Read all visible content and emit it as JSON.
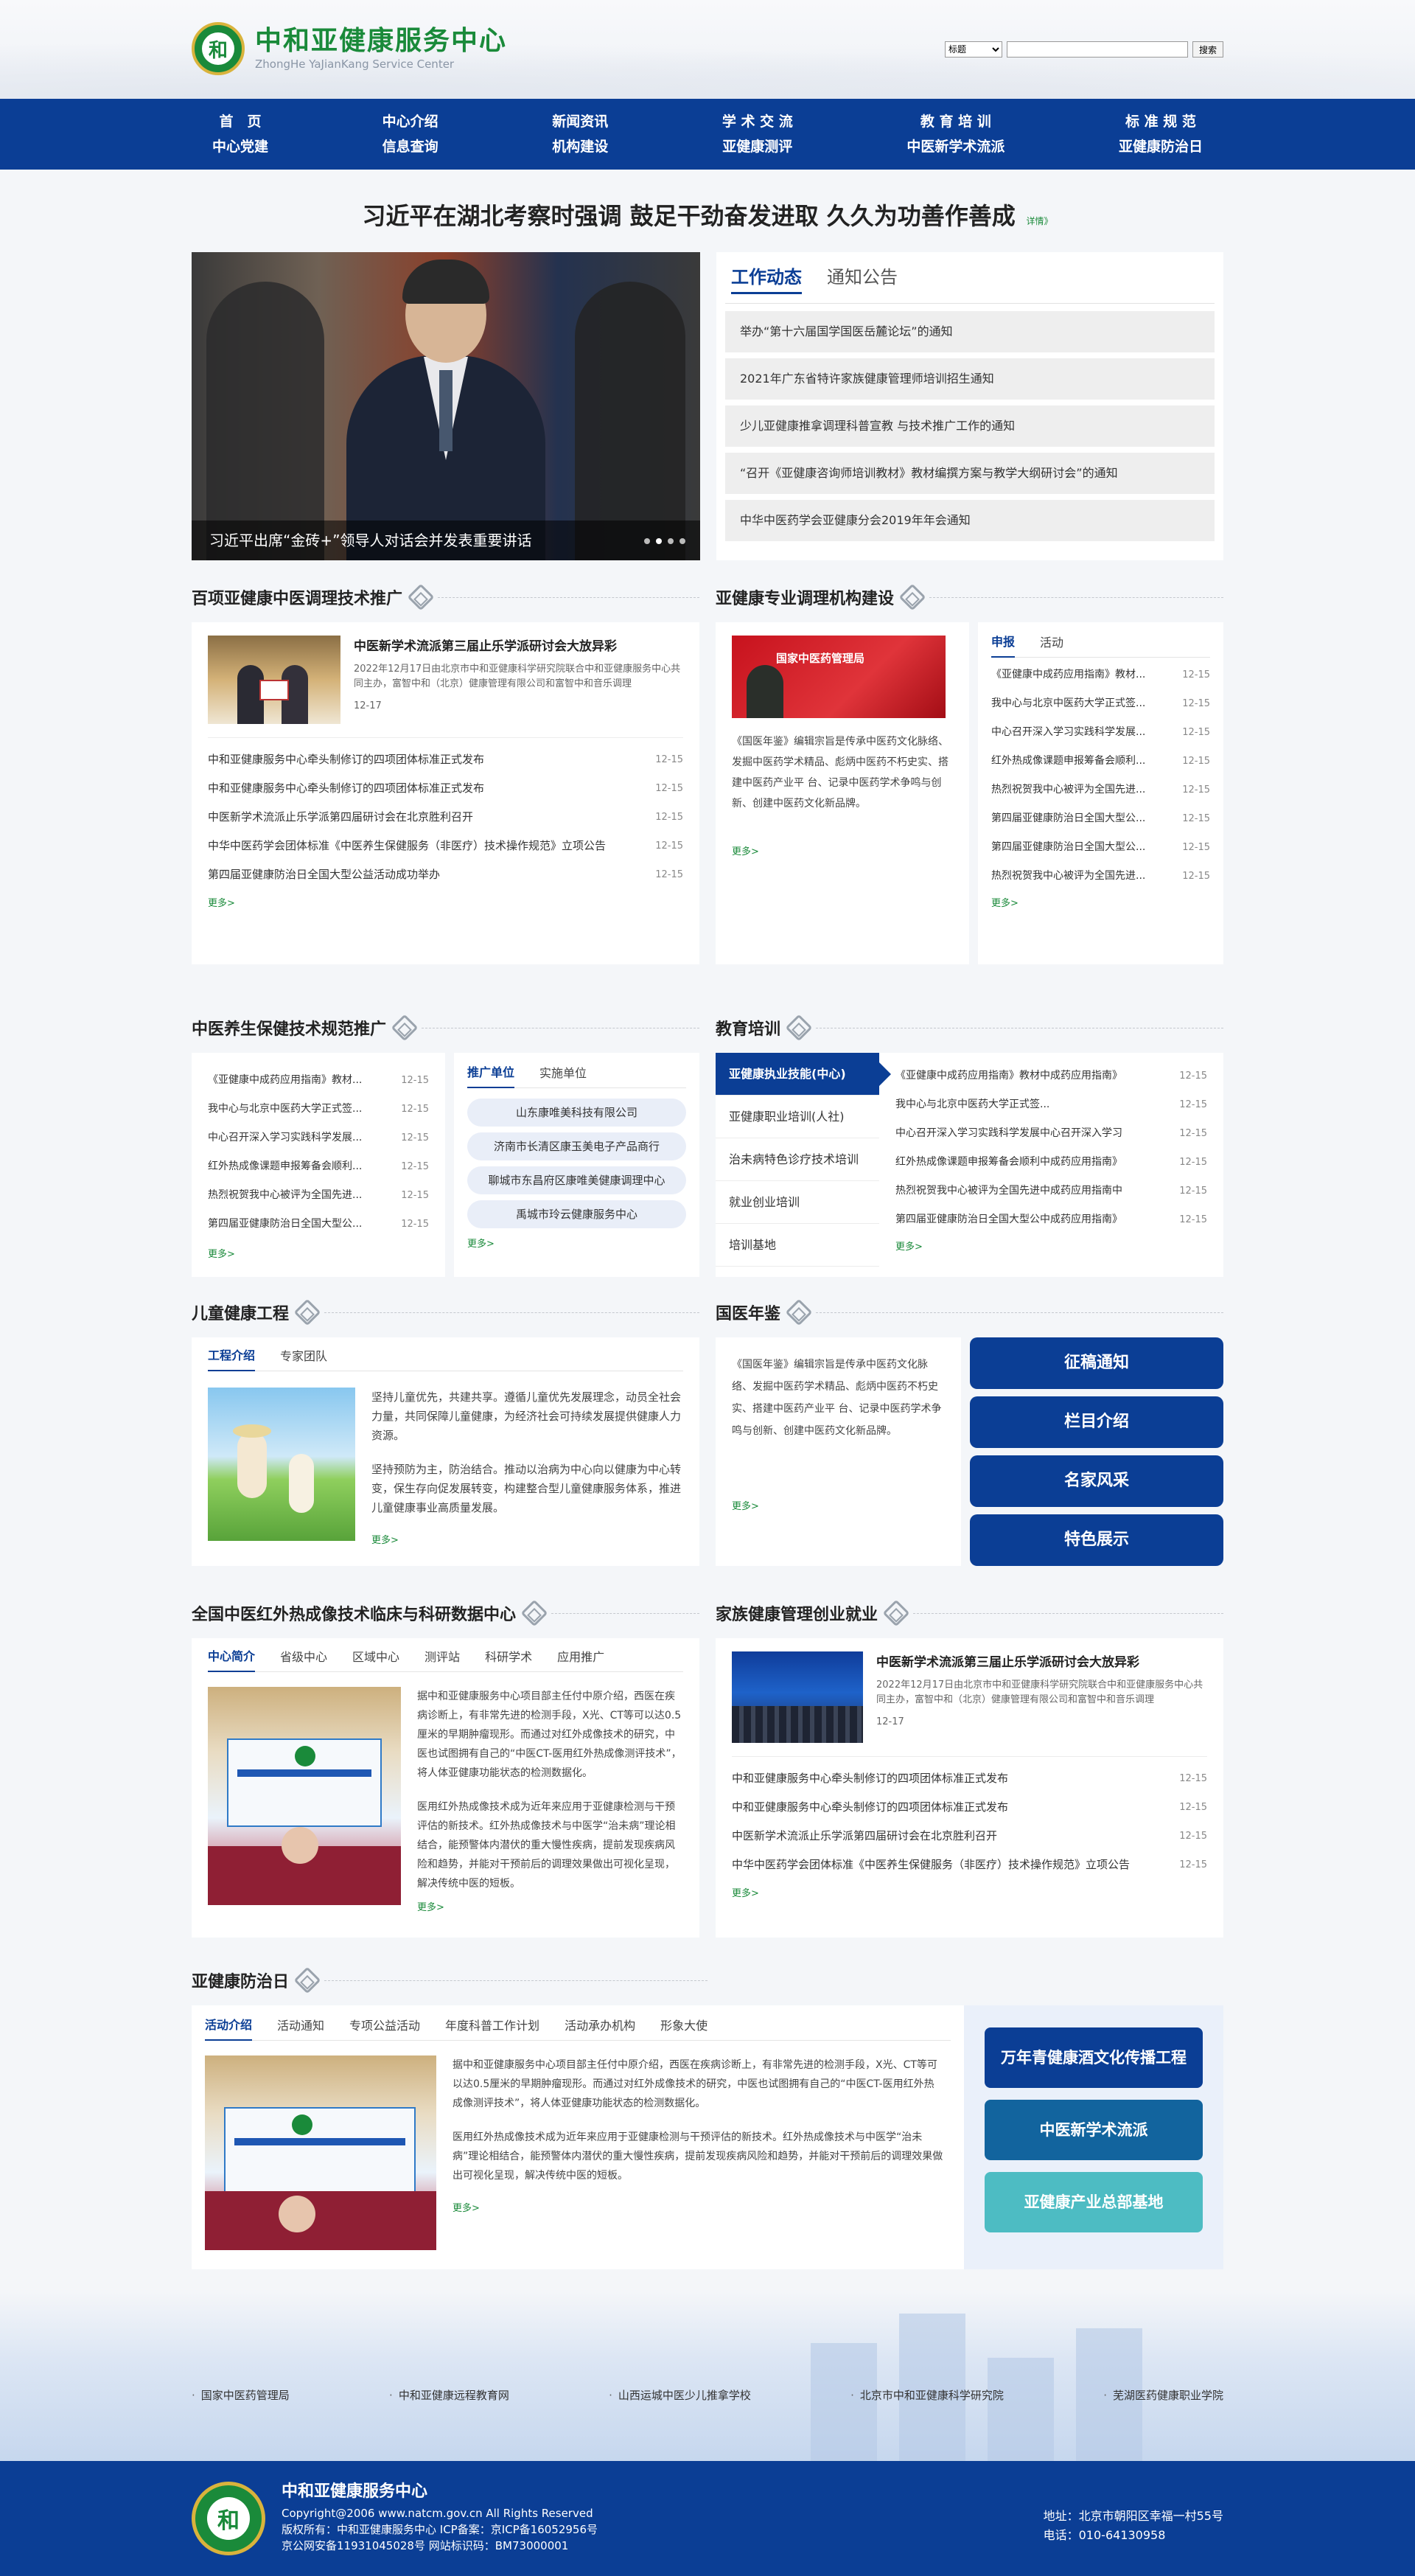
{
  "header": {
    "logo_cn": "中和亚健康服务中心",
    "logo_en": "ZhongHe YaJianKang Service Center",
    "logo_glyph": "和",
    "search": {
      "select_value": "标题",
      "button": "搜索"
    }
  },
  "nav": {
    "top": [
      "首　页",
      "中心介绍",
      "新闻资讯",
      "学 术 交 流",
      "教 育 培 训",
      "标 准 规 范"
    ],
    "bottom": [
      "中心党建",
      "信息查询",
      "机构建设",
      "亚健康测评",
      "中医新学术流派",
      "亚健康防治日"
    ]
  },
  "headline": {
    "title": "习近平在湖北考察时强调 鼓足干劲奋发进取 久久为功善作善成",
    "more": "详情》"
  },
  "banner": {
    "caption": "习近平出席“金砖+”领导人对话会并发表重要讲话"
  },
  "news_panel": {
    "tabs": [
      "工作动态",
      "通知公告"
    ],
    "items": [
      "举办“第十六届国学国医岳麓论坛”的通知",
      "2021年广东省特许家族健康管理师培训招生通知",
      "少儿亚健康推拿调理科普宣教 与技术推广工作的通知",
      "“召开《亚健康咨询师培训教材》教材编撰方案与教学大纲研讨会”的通知",
      "中华中医药学会亚健康分会2019年年会通知"
    ]
  },
  "common": {
    "more": "更多>"
  },
  "sec_tcm_tech": {
    "title": "百项亚健康中医调理技术推广",
    "feature": {
      "title": "中医新学术流派第三届止乐学派研讨会大放异彩",
      "summary": "2022年12月17日由北京市中和亚健康科学研究院联合中和亚健康服务中心共同主办，富智中和（北京）健康管理有限公司和富智中和音乐调理",
      "date": "12-17"
    },
    "items": [
      {
        "t": "中和亚健康服务中心牵头制修订的四项团体标准正式发布",
        "d": "12-15"
      },
      {
        "t": "中和亚健康服务中心牵头制修订的四项团体标准正式发布",
        "d": "12-15"
      },
      {
        "t": "中医新学术流派止乐学派第四届研讨会在北京胜利召开",
        "d": "12-15"
      },
      {
        "t": "中华中医药学会团体标准《中医养生保健服务（非医疗）技术操作规范》立项公告",
        "d": "12-15"
      },
      {
        "t": "第四届亚健康防治日全国大型公益活动成功举办",
        "d": "12-15"
      }
    ]
  },
  "sec_institution": {
    "title": "亚健康专业调理机构建设",
    "thumb_text": "国家中医药管理局",
    "intro": "《国医年鉴》编辑宗旨是传承中医药文化脉络、发掘中医药学术精品、彪炳中医药不朽史实、搭建中医药产业平 台、记录中医药学术争鸣与创新、创建中医药文化新品牌。",
    "tabs": [
      "申报",
      "活动"
    ],
    "items": [
      {
        "t": "《亚健康中成药应用指南》教材...",
        "d": "12-15"
      },
      {
        "t": "我中心与北京中医药大学正式签...",
        "d": "12-15"
      },
      {
        "t": "中心召开深入学习实践科学发展...",
        "d": "12-15"
      },
      {
        "t": "红外热成像课题申报筹备会顺利...",
        "d": "12-15"
      },
      {
        "t": "热烈祝贺我中心被评为全国先进...",
        "d": "12-15"
      },
      {
        "t": "第四届亚健康防治日全国大型公...",
        "d": "12-15"
      },
      {
        "t": "第四届亚健康防治日全国大型公...",
        "d": "12-15"
      },
      {
        "t": "热烈祝贺我中心被评为全国先进...",
        "d": "12-15"
      }
    ]
  },
  "sec_health_standard": {
    "title": "中医养生保健技术规范推广",
    "items": [
      {
        "t": "《亚健康中成药应用指南》教材...",
        "d": "12-15"
      },
      {
        "t": "我中心与北京中医药大学正式签...",
        "d": "12-15"
      },
      {
        "t": "中心召开深入学习实践科学发展...",
        "d": "12-15"
      },
      {
        "t": "红外热成像课题申报筹备会顺利...",
        "d": "12-15"
      },
      {
        "t": "热烈祝贺我中心被评为全国先进...",
        "d": "12-15"
      },
      {
        "t": "第四届亚健康防治日全国大型公...",
        "d": "12-15"
      }
    ],
    "tabs": [
      "推广单位",
      "实施单位"
    ],
    "units": [
      "山东康唯美科技有限公司",
      "济南市长清区康玉美电子产品商行",
      "聊城市东昌府区康唯美健康调理中心",
      "禹城市玲云健康服务中心"
    ]
  },
  "sec_education": {
    "title": "教育培训",
    "menu": [
      "亚健康执业技能(中心)",
      "亚健康职业培训(人社)",
      "治未病特色诊疗技术培训",
      "就业创业培训",
      "培训基地"
    ],
    "items": [
      {
        "t": "《亚健康中成药应用指南》教材中成药应用指南》",
        "d": "12-15"
      },
      {
        "t": "我中心与北京中医药大学正式签...",
        "d": "12-15"
      },
      {
        "t": "中心召开深入学习实践科学发展中心召开深入学习",
        "d": "12-15"
      },
      {
        "t": "红外热成像课题申报筹备会顺利中成药应用指南》",
        "d": "12-15"
      },
      {
        "t": "热烈祝贺我中心被评为全国先进中成药应用指南中",
        "d": "12-15"
      },
      {
        "t": "第四届亚健康防治日全国大型公中成药应用指南》",
        "d": "12-15"
      }
    ]
  },
  "sec_children": {
    "title": "儿童健康工程",
    "tabs": [
      "工程介绍",
      "专家团队"
    ],
    "p1": "坚持儿童优先，共建共享。遵循儿童优先发展理念，动员全社会力量，共同保障儿童健康，为经济社会可持续发展提供健康人力资源。",
    "p2": "坚持预防为主，防治结合。推动以治病为中心向以健康为中心转变，保生存向促发展转变，构建整合型儿童健康服务体系，推进儿童健康事业高质量发展。"
  },
  "sec_yearbook": {
    "title": "国医年鉴",
    "intro": "《国医年鉴》编辑宗旨是传承中医药文化脉络、发掘中医药学术精品、彪炳中医药不朽史实、搭建中医药产业平 台、记录中医药学术争鸣与创新、创建中医药文化新品牌。",
    "buttons": [
      "征稿通知",
      "栏目介绍",
      "名家风采",
      "特色展示"
    ]
  },
  "sec_infrared": {
    "title": "全国中医红外热成像技术临床与科研数据中心",
    "tabs": [
      "中心简介",
      "省级中心",
      "区域中心",
      "测评站",
      "科研学术",
      "应用推广"
    ],
    "p1": "据中和亚健康服务中心项目部主任付中原介绍，西医在疾病诊断上，有非常先进的检测手段，X光、CT等可以达0.5厘米的早期肿瘤现形。而通过对红外成像技术的研究，中医也试图拥有自己的“中医CT-医用红外热成像测评技术”，将人体亚健康功能状态的检测数据化。",
    "p2": "医用红外热成像技术成为近年来应用于亚健康检测与干预评估的新技术。红外热成像技术与中医学“治未病”理论相结合，能预警体内潜伏的重大慢性疾病，提前发现疾病风险和趋势，并能对干预前后的调理效果做出可视化呈现，解决传统中医的短板。"
  },
  "sec_family": {
    "title": "家族健康管理创业就业",
    "feature": {
      "title": "中医新学术流派第三届止乐学派研讨会大放异彩",
      "summary": "2022年12月17日由北京市中和亚健康科学研究院联合中和亚健康服务中心共同主办，富智中和（北京）健康管理有限公司和富智中和音乐调理",
      "date": "12-17"
    },
    "items": [
      {
        "t": "中和亚健康服务中心牵头制修订的四项团体标准正式发布",
        "d": "12-15"
      },
      {
        "t": "中和亚健康服务中心牵头制修订的四项团体标准正式发布",
        "d": "12-15"
      },
      {
        "t": "中医新学术流派止乐学派第四届研讨会在北京胜利召开",
        "d": "12-15"
      },
      {
        "t": "中华中医药学会团体标准《中医养生保健服务（非医疗）技术操作规范》立项公告",
        "d": "12-15"
      }
    ]
  },
  "sec_prevention": {
    "title": "亚健康防治日",
    "tabs": [
      "活动介绍",
      "活动通知",
      "专项公益活动",
      "年度科普工作计划",
      "活动承办机构",
      "形象大使"
    ],
    "p1": "据中和亚健康服务中心项目部主任付中原介绍，西医在疾病诊断上，有非常先进的检测手段，X光、CT等可以达0.5厘米的早期肿瘤现形。而通过对红外成像技术的研究，中医也试图拥有自己的“中医CT-医用红外热成像测评技术”，将人体亚健康功能状态的检测数据化。",
    "p2": "医用红外热成像技术成为近年来应用于亚健康检测与干预评估的新技术。红外热成像技术与中医学“治未病”理论相结合，能预警体内潜伏的重大慢性疾病，提前发现疾病风险和趋势，并能对干预前后的调理效果做出可视化呈现，解决传统中医的短板。",
    "side": [
      "万年青健康酒文化传播工程",
      "中医新学术流派",
      "亚健康产业总部基地"
    ]
  },
  "links": [
    "国家中医药管理局",
    "中和亚健康远程教育网",
    "山西运城中医少儿推拿学校",
    "北京市中和亚健康科学研究院",
    "芜湖医药健康职业学院"
  ],
  "footer": {
    "name": "中和亚健康服务中心",
    "copyright": "Copyright@2006 www.natcm.gov.cn All Rights Reserved",
    "owner": "版权所有：中和亚健康服务中心 ICP备案：京ICP备16052956号",
    "record": "京公网安备11931045028号 网站标识码：BM73000001",
    "address": "地址：北京市朝阳区幸福一村55号",
    "phone": "电话：010-64130958"
  },
  "colors": {
    "primary": "#0b3e95",
    "brand_green": "#1a8a3a",
    "accent_teal": "#4dbcc3"
  }
}
